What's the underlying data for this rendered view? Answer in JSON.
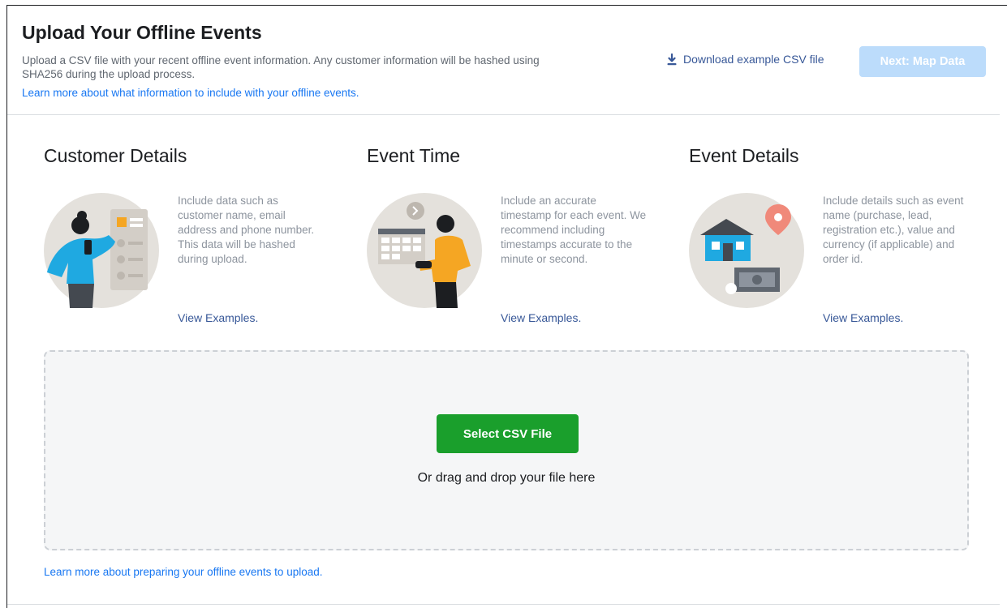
{
  "header": {
    "title": "Upload Your Offline Events",
    "description": "Upload a CSV file with your recent offline event information. Any customer information will be hashed using SHA256 during the upload process.",
    "learn_more": "Learn more about what information to include with your offline events.",
    "download_label": "Download example CSV file",
    "download_icon": "download-icon",
    "next_label": "Next: Map Data"
  },
  "columns": [
    {
      "title": "Customer Details",
      "text": "Include data such as customer name, email address and phone number. This data will be hashed during upload.",
      "link": "View Examples.",
      "icon": "customer-illustration"
    },
    {
      "title": "Event Time",
      "text": "Include an accurate timestamp for each event. We recommend including timestamps accurate to the minute or second.",
      "link": "View Examples.",
      "icon": "event-time-illustration"
    },
    {
      "title": "Event Details",
      "text": "Include details such as event name (purchase, lead, registration etc.), value and currency (if applicable) and order id.",
      "link": "View Examples.",
      "icon": "event-details-illustration"
    }
  ],
  "dropzone": {
    "button_label": "Select CSV File",
    "hint": "Or drag and drop your file here"
  },
  "footer": {
    "learn_more": "Learn more about preparing your offline events to upload."
  },
  "colors": {
    "primary_link": "#1877f2",
    "secondary_link": "#385898",
    "next_button_disabled": "#bcdcfb",
    "select_button": "#1a9f2c",
    "illustration_bg": "#e4e1dc"
  }
}
